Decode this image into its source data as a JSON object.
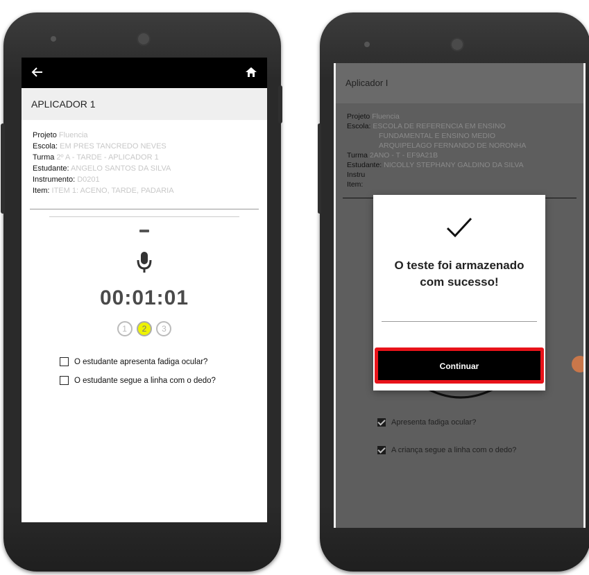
{
  "left": {
    "header_title": "APLICADOR 1",
    "info": [
      {
        "label": "Projeto",
        "value": "Fluencia"
      },
      {
        "label": "Escola:",
        "value": "EM PRES TANCREDO NEVES"
      },
      {
        "label": "Turma",
        "value": "2º A - TARDE - APLICADOR 1"
      },
      {
        "label": "Estudante:",
        "value": "ANGELO SANTOS DA SILVA"
      },
      {
        "label": "Instrumento:",
        "value": "D0201"
      },
      {
        "label": "Item:",
        "value": "ITEM 1: ACENO, TARDE, PADARIA"
      }
    ],
    "timer": "00:01:01",
    "steps": [
      "1",
      "2",
      "3"
    ],
    "active_step": 2,
    "checkboxes": [
      {
        "label": "O estudante apresenta fadiga ocular?",
        "checked": false
      },
      {
        "label": "O estudante segue a linha com o dedo?",
        "checked": false
      }
    ]
  },
  "right": {
    "header_title": "Aplicador I",
    "projeto_label": "Projeto",
    "projeto_value": "Fluencia",
    "escola_label": "Escola:",
    "escola_value_1": "ESCOLA DE REFERENCIA EM ENSINO",
    "escola_value_2": "FUNDAMENTAL E ENSINO MEDIO",
    "escola_value_3": "ARQUIPELAGO FERNANDO DE NORONHA",
    "turma_label": "Turma",
    "turma_value": "2ANO - T - EF9A21B",
    "estudante_label": "Estudante:",
    "estudante_value": "NICOLLY STEPHANY GALDINO DA SILVA",
    "instrumento_label": "Instru",
    "item_label": "Item:",
    "dialog_message": "O teste foi armazenado com sucesso!",
    "dialog_button": "Continuar",
    "checkboxes": [
      {
        "label": "Apresenta fadiga ocular?",
        "checked": true
      },
      {
        "label": "A criança segue a linha com o dedo?",
        "checked": true
      }
    ]
  },
  "colors": {
    "highlight_border": "#e8131a",
    "active_step": "#eef300"
  },
  "icons": [
    "back-arrow-icon",
    "home-icon",
    "microphone-icon",
    "checkmark-icon"
  ]
}
